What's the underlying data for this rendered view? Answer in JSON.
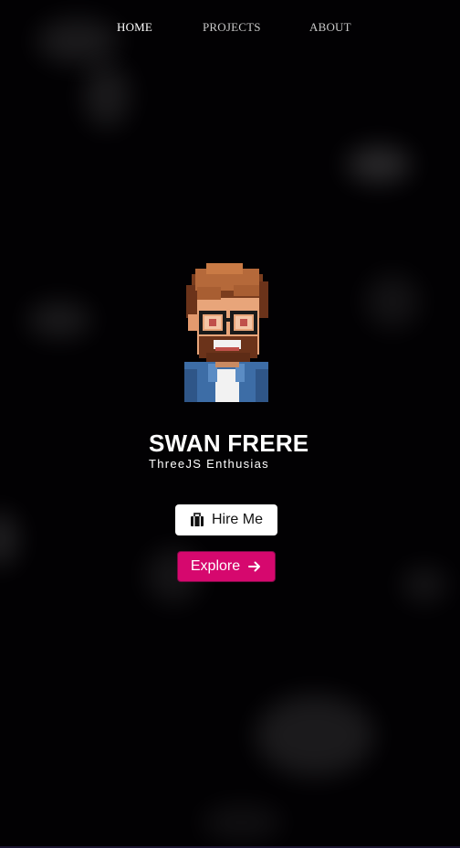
{
  "nav": {
    "items": [
      {
        "label": "HOME",
        "active": true
      },
      {
        "label": "PROJECTS",
        "active": false
      },
      {
        "label": "ABOUT",
        "active": false
      }
    ]
  },
  "hero": {
    "avatar_icon": "pixel-art-developer-avatar",
    "name": "SWAN FRERE",
    "subtitle": "ThreeJS Enthusias"
  },
  "buttons": {
    "hire": {
      "label": "Hire Me",
      "icon": "briefcase-icon"
    },
    "explore": {
      "label": "Explore",
      "icon": "arrow-right-icon"
    }
  },
  "colors": {
    "background": "#020103",
    "accent": "#d6086e",
    "hire_bg": "#ffffff"
  }
}
